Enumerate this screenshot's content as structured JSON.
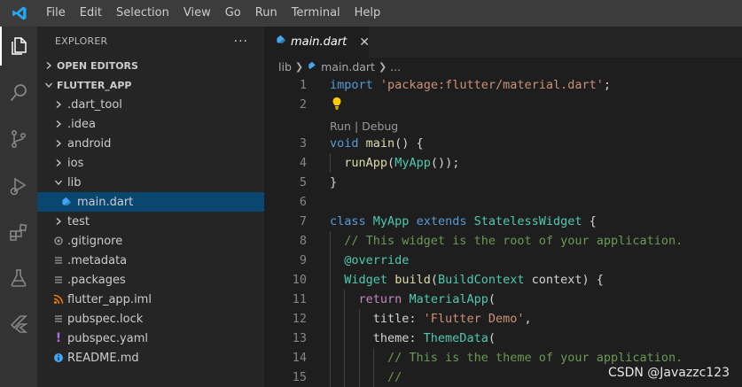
{
  "menu": [
    "File",
    "Edit",
    "Selection",
    "View",
    "Go",
    "Run",
    "Terminal",
    "Help"
  ],
  "activity_bar": [
    "explorer-icon",
    "search-icon",
    "source-control-icon",
    "run-debug-icon",
    "extensions-icon",
    "testing-icon",
    "flutter-icon"
  ],
  "sidebar": {
    "title": "EXPLORER",
    "more": "···",
    "open_editors": "OPEN EDITORS",
    "project": "FLUTTER_APP",
    "tree": [
      {
        "label": ".dart_tool",
        "type": "folder",
        "depth": 1
      },
      {
        "label": ".idea",
        "type": "folder",
        "depth": 1
      },
      {
        "label": "android",
        "type": "folder",
        "depth": 1
      },
      {
        "label": "ios",
        "type": "folder",
        "depth": 1
      },
      {
        "label": "lib",
        "type": "folder-open",
        "depth": 1
      },
      {
        "label": "main.dart",
        "type": "dart",
        "depth": 2,
        "selected": true
      },
      {
        "label": "test",
        "type": "folder",
        "depth": 1
      },
      {
        "label": ".gitignore",
        "type": "gitignore",
        "depth": 1
      },
      {
        "label": ".metadata",
        "type": "lines",
        "depth": 1
      },
      {
        "label": ".packages",
        "type": "lines",
        "depth": 1
      },
      {
        "label": "flutter_app.iml",
        "type": "rss",
        "depth": 1
      },
      {
        "label": "pubspec.lock",
        "type": "lines",
        "depth": 1
      },
      {
        "label": "pubspec.yaml",
        "type": "yaml",
        "depth": 1
      },
      {
        "label": "README.md",
        "type": "info",
        "depth": 1
      }
    ]
  },
  "tab": {
    "label": "main.dart",
    "close": "✕"
  },
  "breadcrumb": {
    "folder": "lib",
    "file": "main.dart",
    "more": "..."
  },
  "codelens": "Run | Debug",
  "code": [
    {
      "n": "1",
      "tokens": [
        [
          "kw",
          "import"
        ],
        [
          "pun",
          " "
        ],
        [
          "str",
          "'package:flutter/material.dart'"
        ],
        [
          "pun",
          ";"
        ]
      ]
    },
    {
      "n": "2",
      "tokens": []
    },
    {
      "n": "3",
      "tokens": [
        [
          "kw",
          "void"
        ],
        [
          "pun",
          " "
        ],
        [
          "fn",
          "main"
        ],
        [
          "pun",
          "() {"
        ]
      ]
    },
    {
      "n": "4",
      "tokens": [
        [
          "pun",
          "  "
        ],
        [
          "fn",
          "runApp"
        ],
        [
          "pun",
          "("
        ],
        [
          "cls",
          "MyApp"
        ],
        [
          "pun",
          "());"
        ]
      ]
    },
    {
      "n": "5",
      "tokens": [
        [
          "pun",
          "}"
        ]
      ]
    },
    {
      "n": "6",
      "tokens": []
    },
    {
      "n": "7",
      "tokens": [
        [
          "kw",
          "class"
        ],
        [
          "pun",
          " "
        ],
        [
          "cls",
          "MyApp"
        ],
        [
          "pun",
          " "
        ],
        [
          "kw",
          "extends"
        ],
        [
          "pun",
          " "
        ],
        [
          "cls",
          "StatelessWidget"
        ],
        [
          "pun",
          " {"
        ]
      ]
    },
    {
      "n": "8",
      "tokens": [
        [
          "pun",
          "  "
        ],
        [
          "com",
          "// This widget is the root of your application."
        ]
      ]
    },
    {
      "n": "9",
      "tokens": [
        [
          "pun",
          "  "
        ],
        [
          "cls",
          "@override"
        ]
      ]
    },
    {
      "n": "10",
      "tokens": [
        [
          "pun",
          "  "
        ],
        [
          "cls",
          "Widget"
        ],
        [
          "pun",
          " "
        ],
        [
          "fn",
          "build"
        ],
        [
          "pun",
          "("
        ],
        [
          "cls",
          "BuildContext"
        ],
        [
          "pun",
          " context) {"
        ]
      ]
    },
    {
      "n": "11",
      "tokens": [
        [
          "pun",
          "    "
        ],
        [
          "ctl",
          "return"
        ],
        [
          "pun",
          " "
        ],
        [
          "cls",
          "MaterialApp"
        ],
        [
          "pun",
          "("
        ]
      ]
    },
    {
      "n": "12",
      "tokens": [
        [
          "pun",
          "      title: "
        ],
        [
          "str",
          "'Flutter Demo'"
        ],
        [
          "pun",
          ","
        ]
      ]
    },
    {
      "n": "13",
      "tokens": [
        [
          "pun",
          "      theme: "
        ],
        [
          "cls",
          "ThemeData"
        ],
        [
          "pun",
          "("
        ]
      ]
    },
    {
      "n": "14",
      "tokens": [
        [
          "pun",
          "        "
        ],
        [
          "com",
          "// This is the theme of your application."
        ]
      ]
    },
    {
      "n": "15",
      "tokens": [
        [
          "pun",
          "        "
        ],
        [
          "com",
          "//"
        ]
      ]
    }
  ],
  "watermark": "CSDN @Javazzc123",
  "colors": {
    "accent": "#007acc",
    "selection": "#094771",
    "keyword": "#569cd6",
    "string": "#ce9178",
    "class": "#4ec9b0",
    "function": "#dcdcaa",
    "comment": "#6a9955"
  }
}
